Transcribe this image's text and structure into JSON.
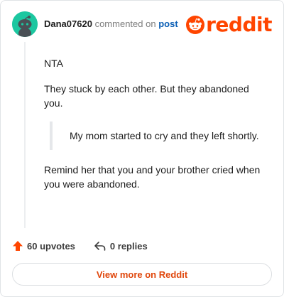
{
  "header": {
    "username": "Dana07620",
    "commented_text": "commented on",
    "post_link": "post",
    "brand": "reddit"
  },
  "comment": {
    "paragraph1": "NTA",
    "paragraph2": "They stuck by each other. But they abandoned you.",
    "quote": "My mom started to cry and they left shortly.",
    "paragraph3": "Remind her that you and your brother cried when you were abandoned."
  },
  "footer": {
    "upvotes": "60 upvotes",
    "replies": "0 replies",
    "view_more": "View more on Reddit"
  },
  "colors": {
    "brand": "#ff4500",
    "avatar": "#1cc7a0",
    "link": "#0a5eb5"
  }
}
